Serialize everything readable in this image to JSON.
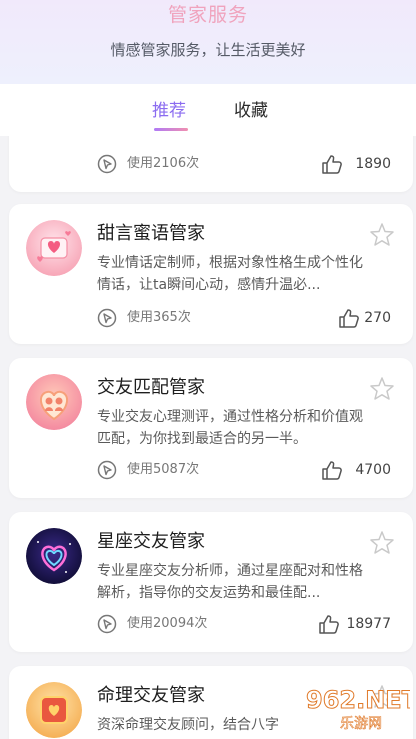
{
  "header": {
    "title": "管家服务",
    "subtitle": "情感管家服务，让生活更美好"
  },
  "tabs": [
    {
      "label": "推荐",
      "active": true
    },
    {
      "label": "收藏",
      "active": false
    }
  ],
  "cards": [
    {
      "title": "",
      "description": "",
      "usage": "使用2106次",
      "likes": "1890"
    },
    {
      "title": "甜言蜜语管家",
      "description": "专业情话定制师，根据对象性格生成个性化情话，让ta瞬间心动，感情升温必...",
      "usage": "使用365次",
      "likes": "270",
      "avatar_icon": "love-heart-icon"
    },
    {
      "title": "交友匹配管家",
      "description": "专业交友心理测评，通过性格分析和价值观匹配，为你找到最适合的另一半。",
      "usage": "使用5087次",
      "likes": "4700",
      "avatar_icon": "heart-couple-icon"
    },
    {
      "title": "星座交友管家",
      "description": "专业星座交友分析师，通过星座配对和性格解析，指导你的交友运势和最佳配...",
      "usage": "使用20094次",
      "likes": "18977",
      "avatar_icon": "neon-heart-icon"
    },
    {
      "title": "命理交友管家",
      "description": "资深命理交友顾问，结合八字",
      "usage": "",
      "likes": "",
      "avatar_icon": "fortune-box-icon"
    }
  ],
  "watermark": {
    "text": "962.NET",
    "sub": "乐游网"
  },
  "colors": {
    "accent": "#8b6cf0",
    "title_pink": "#f0a3bd"
  }
}
